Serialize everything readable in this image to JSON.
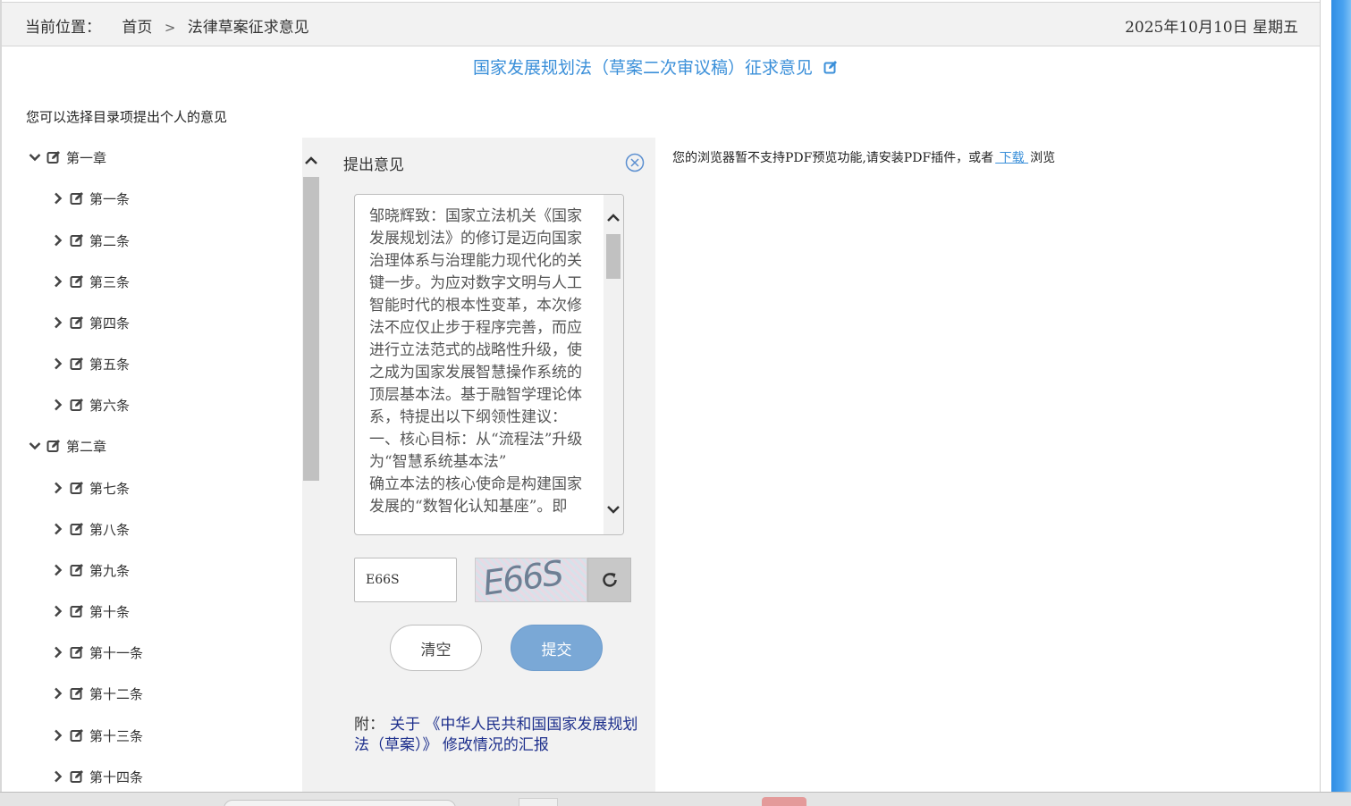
{
  "breadcrumb": {
    "label": "当前位置：",
    "home": "首页",
    "separator": ">",
    "current": "法律草案征求意见"
  },
  "date": "2025年10月10日  星期五",
  "page_title": "国家发展规划法（草案二次审议稿）征求意见",
  "hint": "您可以选择目录项提出个人的意见",
  "tree": {
    "chapter1": "第一章",
    "articles1": [
      "第一条",
      "第二条",
      "第三条",
      "第四条",
      "第五条",
      "第六条"
    ],
    "chapter2": "第二章",
    "articles2": [
      "第七条",
      "第八条",
      "第九条",
      "第十条",
      "第十一条",
      "第十二条",
      "第十三条",
      "第十四条"
    ]
  },
  "panel": {
    "title": "提出意见",
    "comment_text": "邹晓辉致：国家立法机关《国家发展规划法》的修订是迈向国家治理体系与治理能力现代化的关键一步。为应对数字文明与人工智能时代的根本性变革，本次修法不应仅止步于程序完善，而应进行立法范式的战略性升级，使之成为国家发展智慧操作系统的顶层基本法。基于融智学理论体系，特提出以下纲领性建议：\n一、核心目标：从“流程法”升级为“智慧系统基本法”\n确立本法的核心使命是构建国家发展的“数智化认知基座”。即",
    "captcha_value": "E66S",
    "captcha_image_text": "E66S",
    "clear_label": "清空",
    "submit_label": "提交",
    "attach_label": "附：",
    "attach_link": "关于 《中华人民共和国国家发展规划法（草案）》 修改情况的汇报"
  },
  "pdf": {
    "message": "您的浏览器暂不支持PDF预览功能,请安装PDF插件，或者",
    "download": " 下载 ",
    "suffix": "浏览"
  },
  "colors": {
    "title_blue": "#3a8fd9",
    "submit_blue": "#7aa8d6",
    "link_navy": "#1d2f8c",
    "accent_blue": "#2f8de4"
  }
}
